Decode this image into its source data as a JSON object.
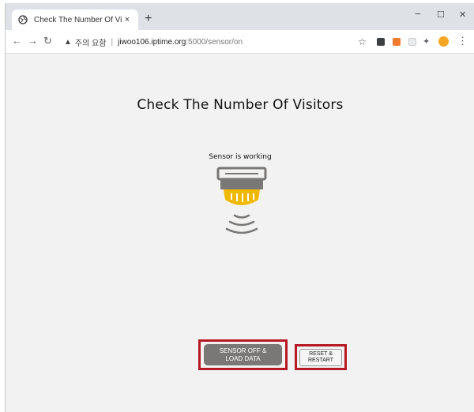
{
  "browser": {
    "tab_title": "Check The Number Of Visitors",
    "tab_close": "×",
    "new_tab": "+",
    "minimize": "−",
    "maximize": "☐",
    "close": "✕",
    "address": {
      "warning_icon": "▲",
      "warning_text": "주의 요함",
      "separator": "|",
      "host": "jiwoo106.iptime.org",
      "path": ":5000/sensor/on"
    }
  },
  "page": {
    "heading": "Check The Number Of Visitors",
    "status": "Sensor is working",
    "sensor_icon": "smoke-sensor-icon",
    "buttons": {
      "sensor_off": "SENSOR OFF & LOAD DATA",
      "reset": "RESET & RESTART"
    }
  },
  "colors": {
    "sensor_yellow": "#f0b800",
    "sensor_gray": "#7a7876",
    "highlight_red": "#b51a24"
  }
}
